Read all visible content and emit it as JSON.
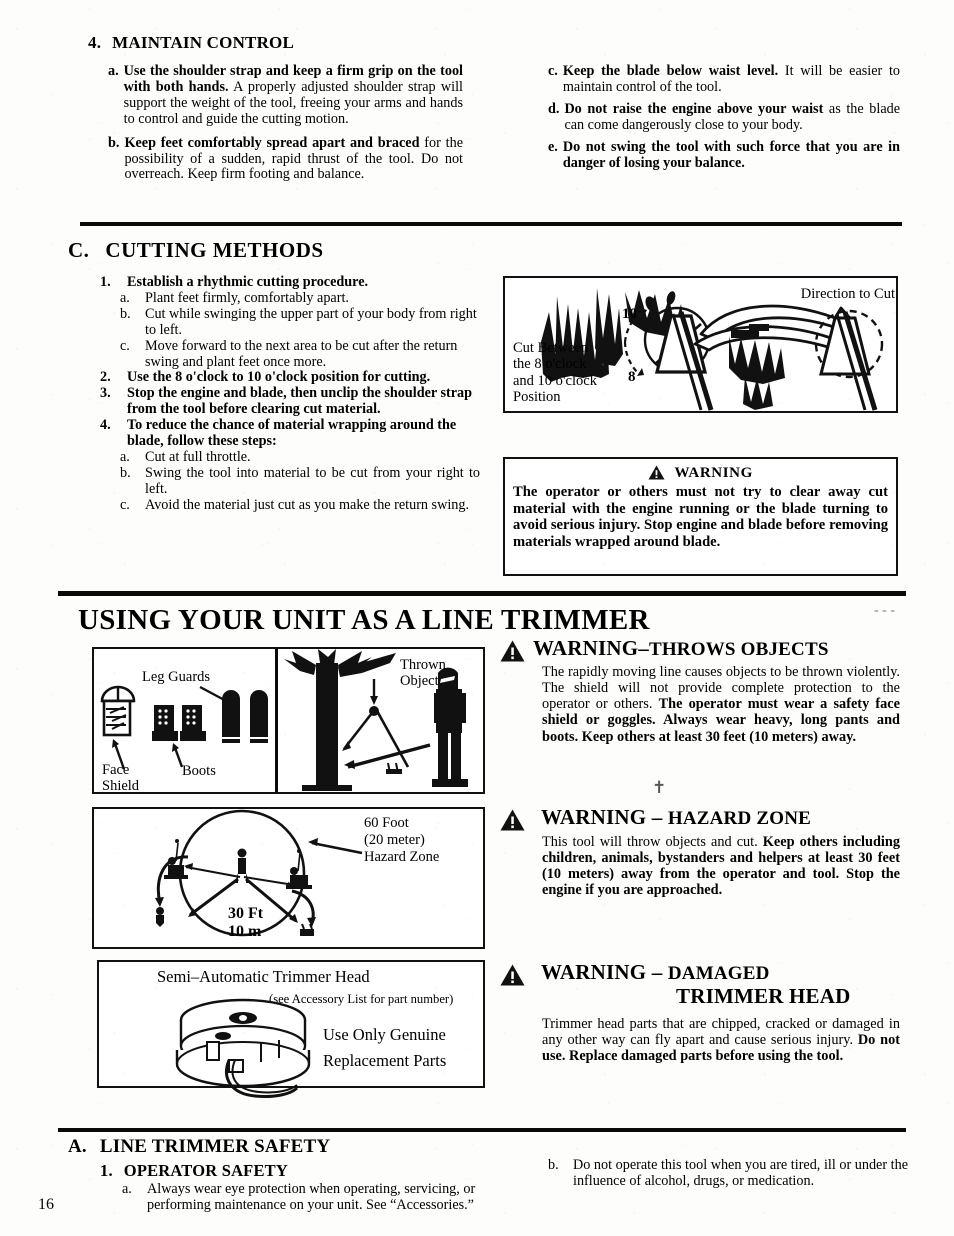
{
  "page": {
    "number": "16"
  },
  "section_maintain": {
    "heading_num": "4.",
    "heading": "MAINTAIN CONTROL",
    "left_items": [
      {
        "marker": "a.",
        "bold_lead": "Use the shoulder strap and keep a firm grip on the tool with both hands.",
        "rest": " A properly adjusted shoulder strap will support the weight of the tool, freeing your arms and hands to control and guide the cutting motion."
      },
      {
        "marker": "b.",
        "bold_lead": "Keep feet comfortably spread apart and braced",
        "rest": " for the possibility of a sudden, rapid thrust of the tool. Do not overreach. Keep firm footing and balance."
      }
    ],
    "right_items": [
      {
        "marker": "c.",
        "bold_lead": "Keep the blade below waist level.",
        "rest": " It will be easier to maintain control of the tool."
      },
      {
        "marker": "d.",
        "bold_lead": "Do not raise the engine above your waist",
        "rest": " as the blade can come dangerously close to your body."
      },
      {
        "marker": "e.",
        "bold_lead": "Do not swing the tool with such force that you are in danger of losing your balance.",
        "rest": ""
      }
    ]
  },
  "section_cutting": {
    "heading_letter": "C.",
    "heading": "CUTTING METHODS",
    "items": [
      {
        "marker": "1.",
        "bold": true,
        "text": "Establish a rhythmic cutting procedure."
      },
      {
        "marker": "a.",
        "bold": false,
        "sub": true,
        "text": "Plant feet firmly, comfortably apart."
      },
      {
        "marker": "b.",
        "bold": false,
        "sub": true,
        "text": "Cut while swinging the upper part of your body from right to left."
      },
      {
        "marker": "c.",
        "bold": false,
        "sub": true,
        "text": "Move forward to the next area to be cut after the return swing and plant feet once more."
      },
      {
        "marker": "2.",
        "bold": true,
        "text": "Use the 8 o'clock to 10 o'clock position for cutting."
      },
      {
        "marker": "3.",
        "bold": true,
        "text": "Stop the engine and blade, then unclip the shoulder strap from the tool before clearing cut material."
      },
      {
        "marker": "4.",
        "bold": true,
        "text": "To reduce the chance of material wrapping around the blade, follow these steps:"
      },
      {
        "marker": "a.",
        "bold": false,
        "sub": true,
        "text": "Cut at full throttle."
      },
      {
        "marker": "b.",
        "bold": false,
        "sub": true,
        "text": "Swing the tool into material to be cut from your right to left."
      },
      {
        "marker": "c.",
        "bold": false,
        "sub": true,
        "text": "Avoid the material just cut as you make the return swing."
      }
    ]
  },
  "cutting_diagram": {
    "label_direction": "Direction to Cut",
    "label_cut_between": "Cut Between\nthe 8 o'clock\nand 10 o'clock\nPosition",
    "clock_10": "10",
    "clock_8": "8"
  },
  "warning_clearing": {
    "title": "WARNING",
    "body": "The operator or others must not try to clear away cut material with the engine running or the blade turning to avoid serious injury. Stop engine and blade before removing materials wrapped around blade."
  },
  "section_trimmer": {
    "heading": "USING YOUR UNIT AS A LINE TRIMMER"
  },
  "ppe_diagram": {
    "leg_guards": "Leg Guards",
    "face_shield": "Face\nShield",
    "boots": "Boots",
    "thrown_object": "Thrown\nObject"
  },
  "hazard_diagram": {
    "zone_label": "60 Foot\n(20 meter)\nHazard Zone",
    "radius_label": "30 Ft\n10 m"
  },
  "head_diagram": {
    "title": "Semi–Automatic Trimmer Head",
    "note": "(see Accessory List for part number)",
    "genuine_line1": "Use Only Genuine",
    "genuine_line2": "Replacement Parts"
  },
  "warnings": [
    {
      "id": "throws-objects",
      "title_main": "WARNING",
      "title_dash": "–",
      "title_rest": "THROWS OBJECTS",
      "body_normal_1": "The rapidly moving line causes objects to be thrown violently. The shield will not provide complete protection to the operator or others. ",
      "body_bold_1": "The operator must wear a safety face shield or goggles. Always wear heavy, long pants and boots. Keep others at least 30 feet (10 meters) away."
    },
    {
      "id": "hazard-zone",
      "title_main": "WARNING",
      "title_dash": "–",
      "title_rest": "HAZARD ZONE",
      "body_normal_1": "This tool will throw objects and cut. ",
      "body_bold_1": "Keep others including children, animals, bystanders and helpers at least 30 feet (10 meters) away from the operator and tool. Stop the engine if you are approached."
    },
    {
      "id": "damaged-trimmer-head",
      "title_main": "WARNING",
      "title_dash": "–",
      "title_rest": "DAMAGED",
      "title_rest2": "TRIMMER HEAD",
      "body_normal_1": "Trimmer head parts that are chipped, cracked or damaged in any other way can fly apart and cause serious injury. ",
      "body_bold_1": "Do not use. Replace damaged parts before using the tool."
    }
  ],
  "section_line_trimmer_safety": {
    "heading_letter": "A.",
    "heading": "LINE TRIMMER SAFETY",
    "sub_num": "1.",
    "sub_heading": "OPERATOR SAFETY",
    "left_items": [
      {
        "marker": "a.",
        "text": "Always wear eye protection when operating, servicing, or performing maintenance on your unit. See “Accessories.”"
      }
    ],
    "right_items": [
      {
        "marker": "b.",
        "text": "Do not operate this tool when you are tired, ill or under the influence of alcohol, drugs, or medication."
      }
    ]
  }
}
